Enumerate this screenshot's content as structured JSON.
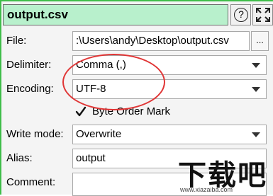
{
  "header": {
    "title": "output.csv",
    "help_icon_glyph": "?"
  },
  "fields": {
    "file_label": "File:",
    "file_value": ":\\Users\\andy\\Desktop\\output.csv",
    "browse_label": "...",
    "delimiter_label": "Delimiter:",
    "delimiter_value": "Comma (,)",
    "encoding_label": "Encoding:",
    "encoding_value": "UTF-8",
    "bom_label": "Byte Order Mark",
    "bom_checked": true,
    "write_mode_label": "Write mode:",
    "write_mode_value": "Overwrite",
    "alias_label": "Alias:",
    "alias_value": "output",
    "comment_label": "Comment:",
    "comment_value": ""
  },
  "watermark": {
    "big_text": "下载吧",
    "small_text": "www.xiazaiba.com"
  },
  "colors": {
    "accent_green": "#3fbd49",
    "title_bg": "#b8f0cc",
    "annotation_red": "#e03535"
  }
}
